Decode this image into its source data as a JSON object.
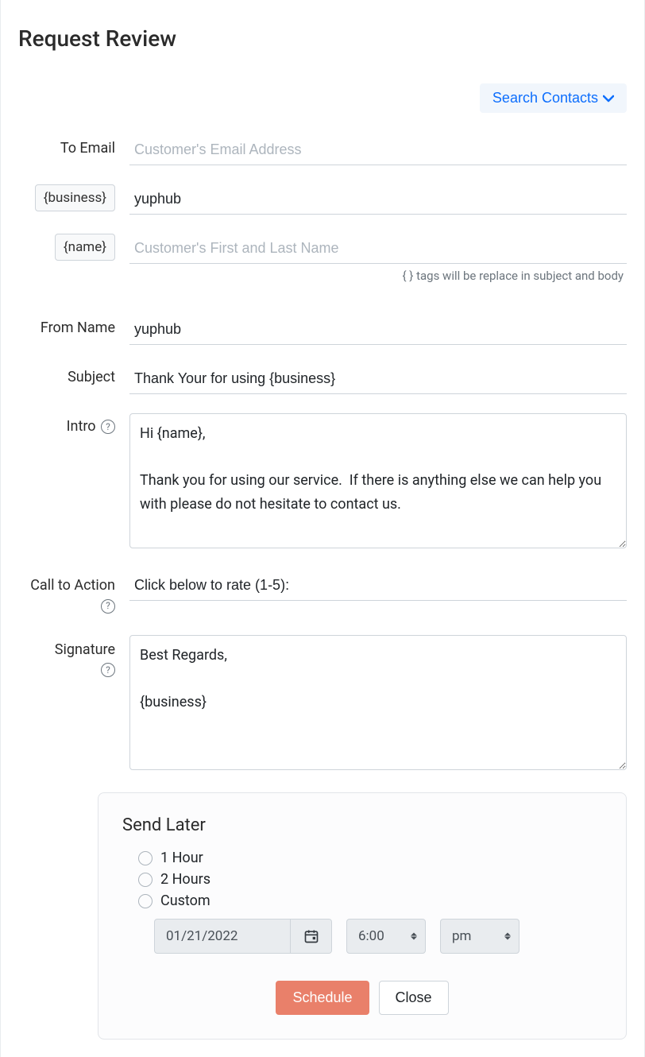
{
  "page": {
    "title": "Request Review"
  },
  "toolbar": {
    "search_contacts_label": "Search Contacts"
  },
  "labels": {
    "to_email": "To Email",
    "business_tag": "{business}",
    "name_tag": "{name}",
    "from_name": "From Name",
    "subject": "Subject",
    "intro": "Intro",
    "call_to_action": "Call to Action",
    "signature": "Signature"
  },
  "placeholders": {
    "to_email": "Customer's Email Address",
    "name": "Customer's First and Last Name"
  },
  "values": {
    "business": "yuphub",
    "from_name": "yuphub",
    "subject": "Thank Your for using {business}",
    "intro": "Hi {name},\n\nThank you for using our service.  If there is anything else we can help you with please do not hesitate to contact us.",
    "call_to_action": "Click below to rate (1-5):",
    "signature": "Best Regards,\n\n{business}"
  },
  "notes": {
    "tags_replace": "{ } tags will be replace in subject and body"
  },
  "send_later": {
    "title": "Send Later",
    "options": {
      "one_hour": "1 Hour",
      "two_hours": "2 Hours",
      "custom": "Custom"
    },
    "date": "01/21/2022",
    "time": "6:00",
    "ampm": "pm"
  },
  "buttons": {
    "schedule": "Schedule",
    "close": "Close"
  }
}
